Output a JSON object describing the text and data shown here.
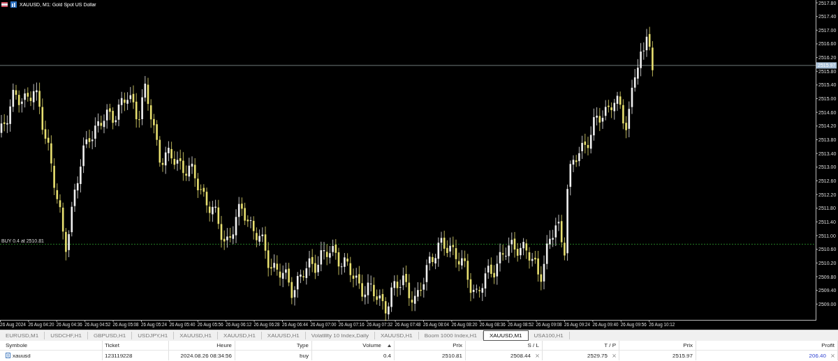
{
  "chart": {
    "title": "XAUUSD, M1:  Gold Spot US Dollar",
    "price_labels": [
      "2517.80",
      "2517.40",
      "2517.00",
      "2516.60",
      "2516.20",
      "2515.80",
      "2515.40",
      "2515.00",
      "2514.60",
      "2514.20",
      "2513.80",
      "2513.40",
      "2513.00",
      "2512.60",
      "2512.20",
      "2511.80",
      "2511.40",
      "2511.00",
      "2510.60",
      "2510.20",
      "2509.80",
      "2509.40",
      "2509.00"
    ],
    "current_price": "2515.97",
    "order_line": "BUY 0.4 at 2510.81",
    "time_labels": [
      "26 Aug 2024",
      "26 Aug 04:20",
      "26 Aug 04:36",
      "26 Aug 04:52",
      "26 Aug 05:08",
      "26 Aug 05:24",
      "26 Aug 05:40",
      "26 Aug 05:56",
      "26 Aug 06:12",
      "26 Aug 06:28",
      "26 Aug 06:44",
      "26 Aug 07:00",
      "26 Aug 07:16",
      "26 Aug 07:32",
      "26 Aug 07:48",
      "26 Aug 08:04",
      "26 Aug 08:20",
      "26 Aug 08:36",
      "26 Aug 08:52",
      "26 Aug 09:08",
      "26 Aug 09:24",
      "26 Aug 09:40",
      "26 Aug 09:56",
      "26 Aug 10:12"
    ]
  },
  "tabs": [
    {
      "label": "EURUSD,M1",
      "selected": false
    },
    {
      "label": "USDCHF,H1",
      "selected": false
    },
    {
      "label": "GBPUSD,H1",
      "selected": false
    },
    {
      "label": "USDJPY,H1",
      "selected": false
    },
    {
      "label": "XAUUSD,H1",
      "selected": false
    },
    {
      "label": "XAUUSD,H1",
      "selected": false
    },
    {
      "label": "XAUUSD,H1",
      "selected": false
    },
    {
      "label": "Volatility 10 Index,Daily",
      "selected": false
    },
    {
      "label": "XAUUSD,H1",
      "selected": false
    },
    {
      "label": "Boom 1000 Index,H1",
      "selected": false
    },
    {
      "label": "XAUUSD,M1",
      "selected": true
    },
    {
      "label": "USA100,H1",
      "selected": false
    }
  ],
  "table": {
    "columns": [
      {
        "label": "Symbole",
        "kind": "text",
        "sorted": false,
        "closable": false
      },
      {
        "label": "Ticket",
        "kind": "text",
        "sorted": false,
        "closable": false
      },
      {
        "label": "Heure",
        "kind": "number",
        "sorted": false,
        "closable": false
      },
      {
        "label": "Type",
        "kind": "number",
        "sorted": false,
        "closable": false
      },
      {
        "label": "Volume",
        "kind": "number",
        "sorted": true,
        "closable": false
      },
      {
        "label": "Prix",
        "kind": "number",
        "sorted": false,
        "closable": false
      },
      {
        "label": "S / L",
        "kind": "number",
        "sorted": false,
        "closable": true
      },
      {
        "label": "T / P",
        "kind": "number",
        "sorted": false,
        "closable": true
      },
      {
        "label": "Prix",
        "kind": "number",
        "sorted": false,
        "closable": false
      },
      {
        "label": "Profit",
        "kind": "profit",
        "sorted": false,
        "closable": true
      }
    ],
    "rows": [
      {
        "cells": [
          "xauusd",
          "123119228",
          "2024.08.26 08:34:56",
          "buy",
          "0.4",
          "2510.81",
          "2508.44",
          "2529.75",
          "2515.97",
          "206.40"
        ]
      }
    ]
  }
}
